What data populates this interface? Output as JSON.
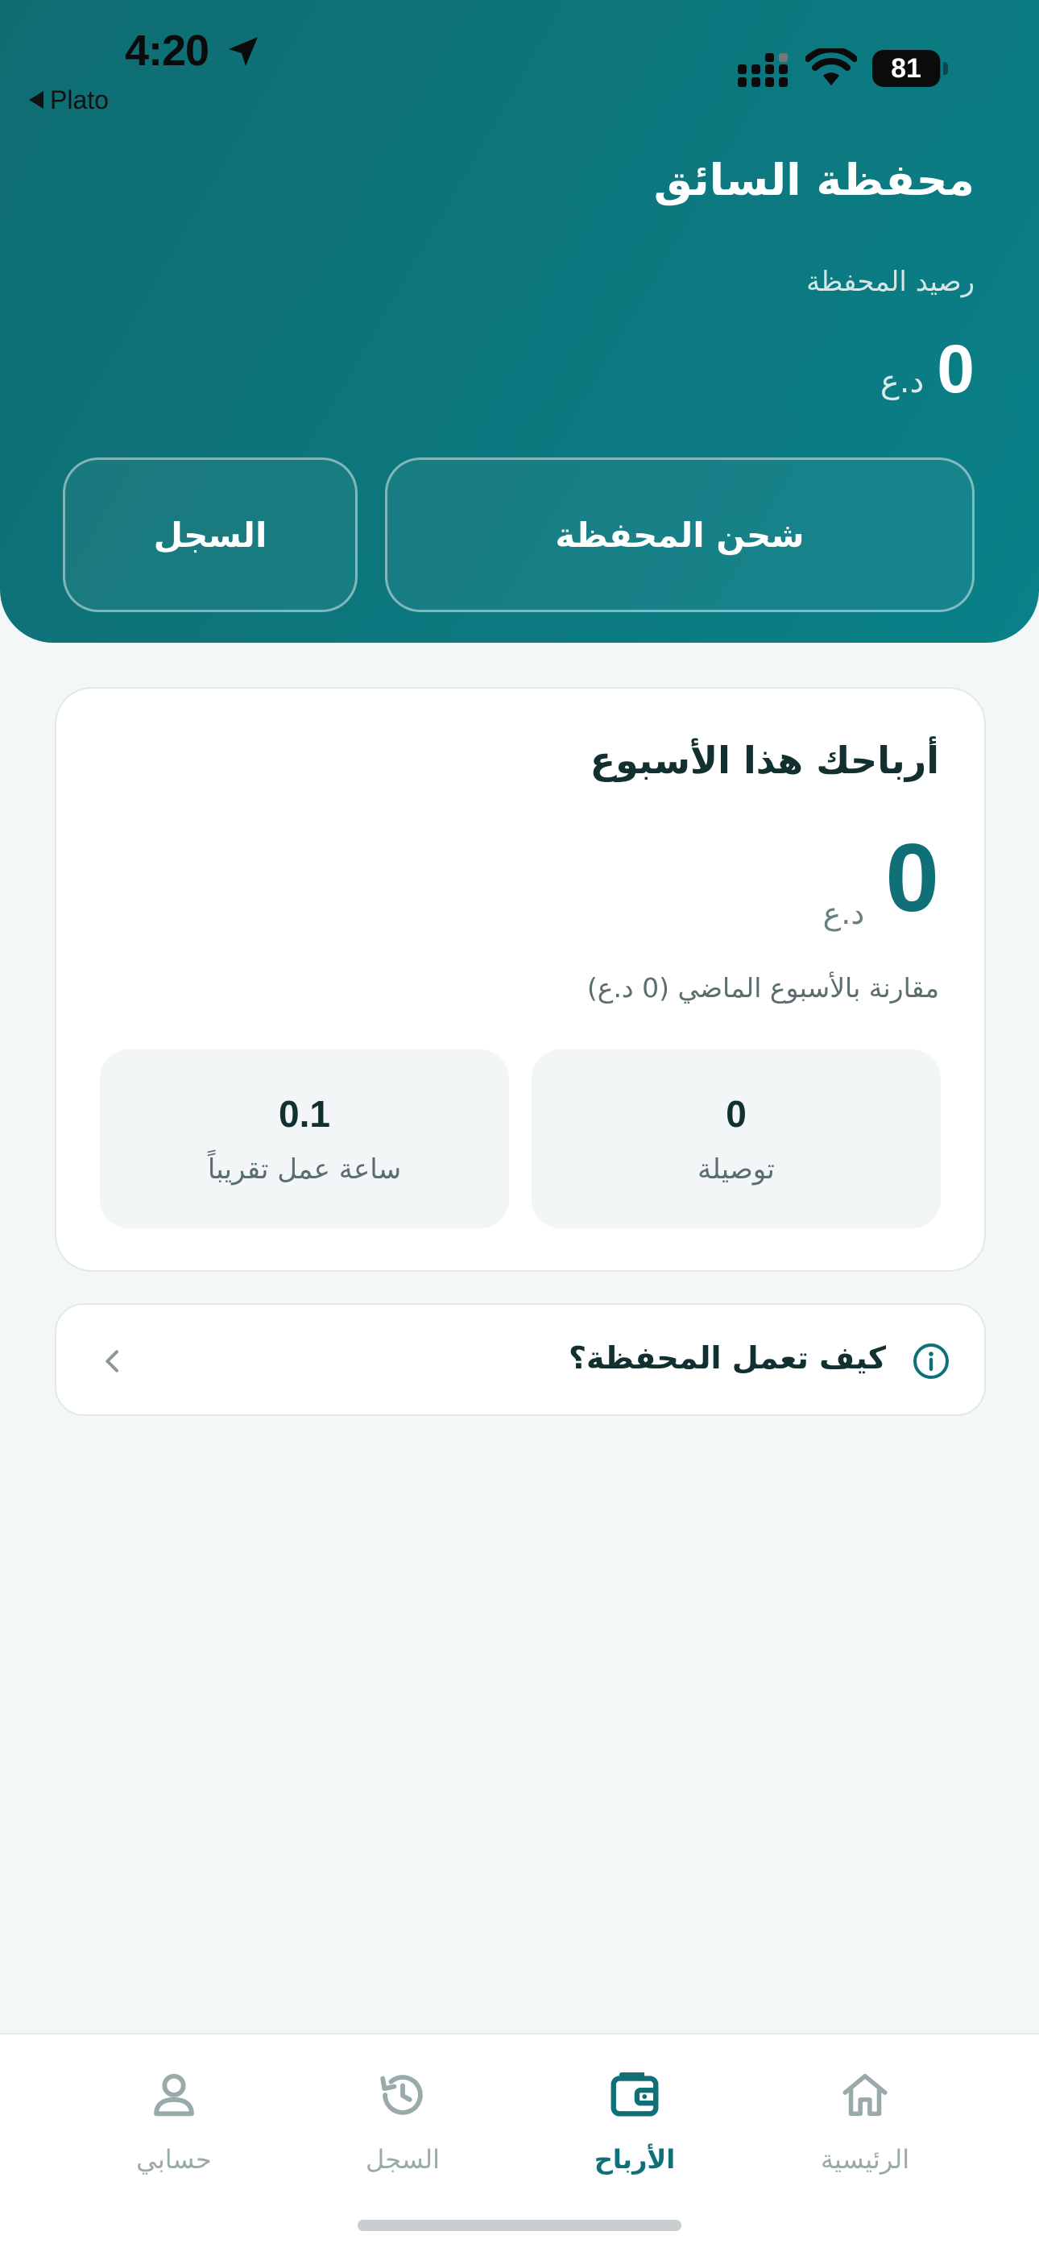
{
  "status_bar": {
    "time": "4:20",
    "back_app": "Plato",
    "battery": "81"
  },
  "header": {
    "title": "محفظة السائق",
    "balance_label": "رصيد المحفظة",
    "balance_value": "0",
    "balance_currency": "د.ع",
    "charge_button": "شحن المحفظة",
    "history_button": "السجل"
  },
  "earnings": {
    "title": "أرباحك هذا الأسبوع",
    "value": "0",
    "currency": "د.ع",
    "comparison": "مقارنة بالأسبوع الماضي (0 د.ع)",
    "stats": [
      {
        "value": "0",
        "label": "توصيلة"
      },
      {
        "value": "0.1",
        "label": "ساعة عمل تقريباً"
      }
    ]
  },
  "info": {
    "text": "كيف تعمل المحفظة؟"
  },
  "tabbar": {
    "items": [
      {
        "label": "الرئيسية",
        "icon": "home-icon"
      },
      {
        "label": "الأرباح",
        "icon": "wallet-icon",
        "active": true
      },
      {
        "label": "السجل",
        "icon": "history-icon"
      },
      {
        "label": "حسابي",
        "icon": "user-icon"
      }
    ]
  },
  "colors": {
    "primary": "#0f7077",
    "header_start": "#0f6d72",
    "header_end": "#0a8088",
    "background": "#f3f7f8",
    "muted": "#9aaaab"
  }
}
